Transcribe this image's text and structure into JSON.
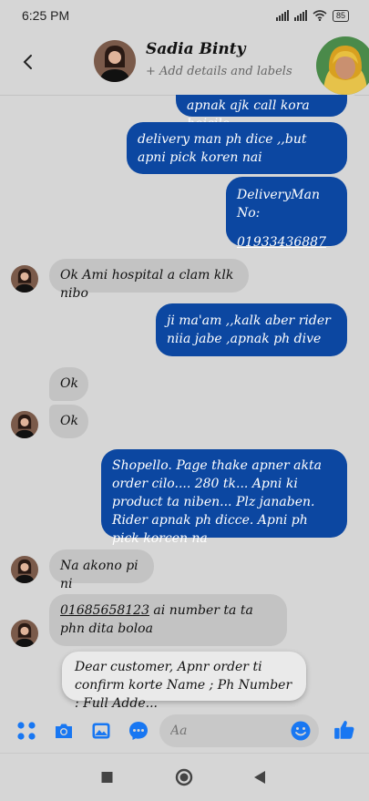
{
  "status_bar": {
    "time": "6:25 PM",
    "battery": "85"
  },
  "header": {
    "contact_name": "Sadia Binty",
    "subtitle": "+ Add details and labels"
  },
  "messages": [
    {
      "side": "sent",
      "text": "apnak ajk call kora hoicilo"
    },
    {
      "side": "sent",
      "text": "delivery man ph dice ,,but apni pick koren nai"
    },
    {
      "side": "sent",
      "text_line1": "DeliveryMan No:",
      "phone": "01933436887"
    },
    {
      "side": "recv",
      "text": "Ok Ami hospital a clam klk nibo"
    },
    {
      "side": "sent",
      "text": "ji ma'am ,,kalk aber rider niia jabe ,apnak ph dive"
    },
    {
      "side": "recv",
      "text": "Ok"
    },
    {
      "side": "recv",
      "text": "Ok"
    },
    {
      "side": "sent",
      "text": "Shopello. Page thake apner akta order cilo.... 280 tk... Apni ki product ta niben... Plz janaben. Rider apnak ph dicce. Apni ph pick korcen na"
    },
    {
      "side": "recv",
      "text": "Na akono pi ni"
    },
    {
      "side": "recv",
      "phone": "01685658123",
      "text": " ai number ta ta phn dita boloa"
    }
  ],
  "suggested_reply": "Dear customer, Apnr order ti confirm korte Name ; Ph Number : Full Adde...",
  "composer": {
    "placeholder": "Aa"
  },
  "colors": {
    "sent_bubble": "#0c47a1",
    "recv_bubble": "#c3c3c3",
    "accent": "#1877f2"
  }
}
